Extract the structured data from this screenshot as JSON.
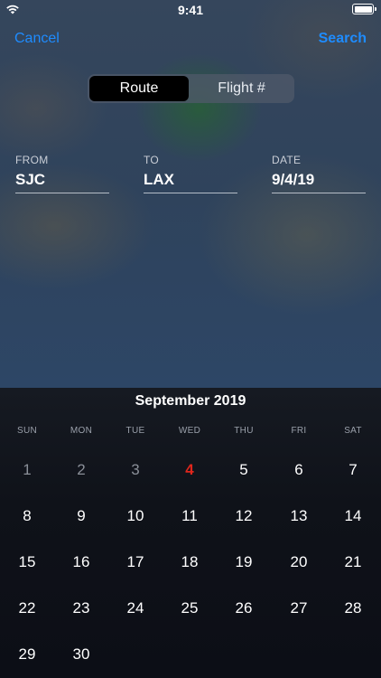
{
  "status_bar": {
    "time": "9:41",
    "wifi_icon": "wifi-icon",
    "battery_icon": "battery-icon"
  },
  "nav": {
    "cancel_label": "Cancel",
    "search_label": "Search",
    "accent_color": "#1e8cff"
  },
  "segments": [
    {
      "label": "Route",
      "selected": true
    },
    {
      "label": "Flight #",
      "selected": false
    }
  ],
  "fields": {
    "from": {
      "label": "FROM",
      "value": "SJC"
    },
    "to": {
      "label": "TO",
      "value": "LAX"
    },
    "date": {
      "label": "DATE",
      "value": "9/4/19"
    }
  },
  "calendar": {
    "month_title": "September 2019",
    "weekdays": [
      "SUN",
      "MON",
      "TUE",
      "WED",
      "THU",
      "FRI",
      "SAT"
    ],
    "weeks": [
      [
        "1",
        "2",
        "3",
        "4",
        "5",
        "6",
        "7"
      ],
      [
        "8",
        "9",
        "10",
        "11",
        "12",
        "13",
        "14"
      ],
      [
        "15",
        "16",
        "17",
        "18",
        "19",
        "20",
        "21"
      ],
      [
        "22",
        "23",
        "24",
        "25",
        "26",
        "27",
        "28"
      ],
      [
        "29",
        "30"
      ]
    ],
    "past_days": [
      "1",
      "2",
      "3"
    ],
    "selected_day": "4",
    "selected_color": "#e0261c"
  }
}
